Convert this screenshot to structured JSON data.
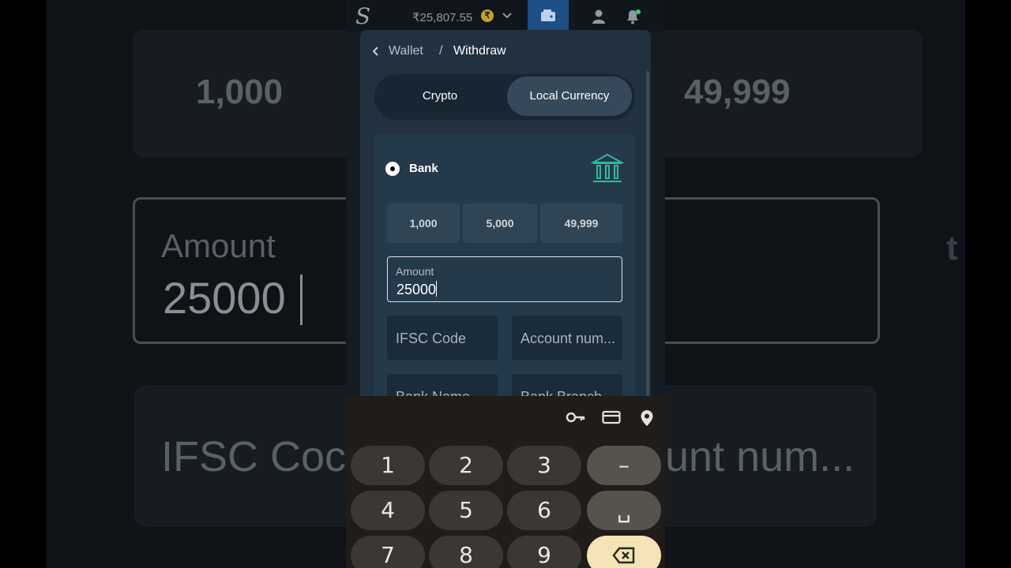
{
  "background": {
    "chips": [
      "1,000",
      "49,999"
    ],
    "amount_label": "Amount",
    "amount_value": "25000",
    "ifsc": "IFSC Coc",
    "account": "unt num...",
    "stray_t": "t"
  },
  "topbar": {
    "balance": "₹25,807.55",
    "coin_symbol": "₹",
    "icons": [
      "chevron-down-icon",
      "wallet-icon",
      "user-icon",
      "bell-icon"
    ]
  },
  "breadcrumb": {
    "parent": "Wallet",
    "separator": "/",
    "current": "Withdraw"
  },
  "tabs": [
    {
      "label": "Crypto",
      "active": false
    },
    {
      "label": "Local Currency",
      "active": true
    }
  ],
  "method": {
    "label": "Bank",
    "selected": true,
    "icon": "bank-icon"
  },
  "quick_amounts": [
    "1,000",
    "5,000",
    "49,999"
  ],
  "amount_field": {
    "label": "Amount",
    "value": "25000"
  },
  "fields": {
    "ifsc_placeholder": "IFSC Code",
    "account_placeholder": "Account num...",
    "bank_name_placeholder": "Bank Name",
    "bank_branch_placeholder": "Bank Branch"
  },
  "keyboard": {
    "toolbar_icons": [
      "key-icon",
      "card-icon",
      "location-pin-icon"
    ],
    "keys": [
      "1",
      "2",
      "3",
      "–",
      "4",
      "5",
      "6",
      "␣",
      "7",
      "8",
      "9",
      "⌫"
    ]
  },
  "colors": {
    "accent_wallet": "#1d4f86",
    "notification_dot": "#2bd66f",
    "bank_icon": "#2fb89f",
    "delete_key": "#f3e3b5"
  }
}
